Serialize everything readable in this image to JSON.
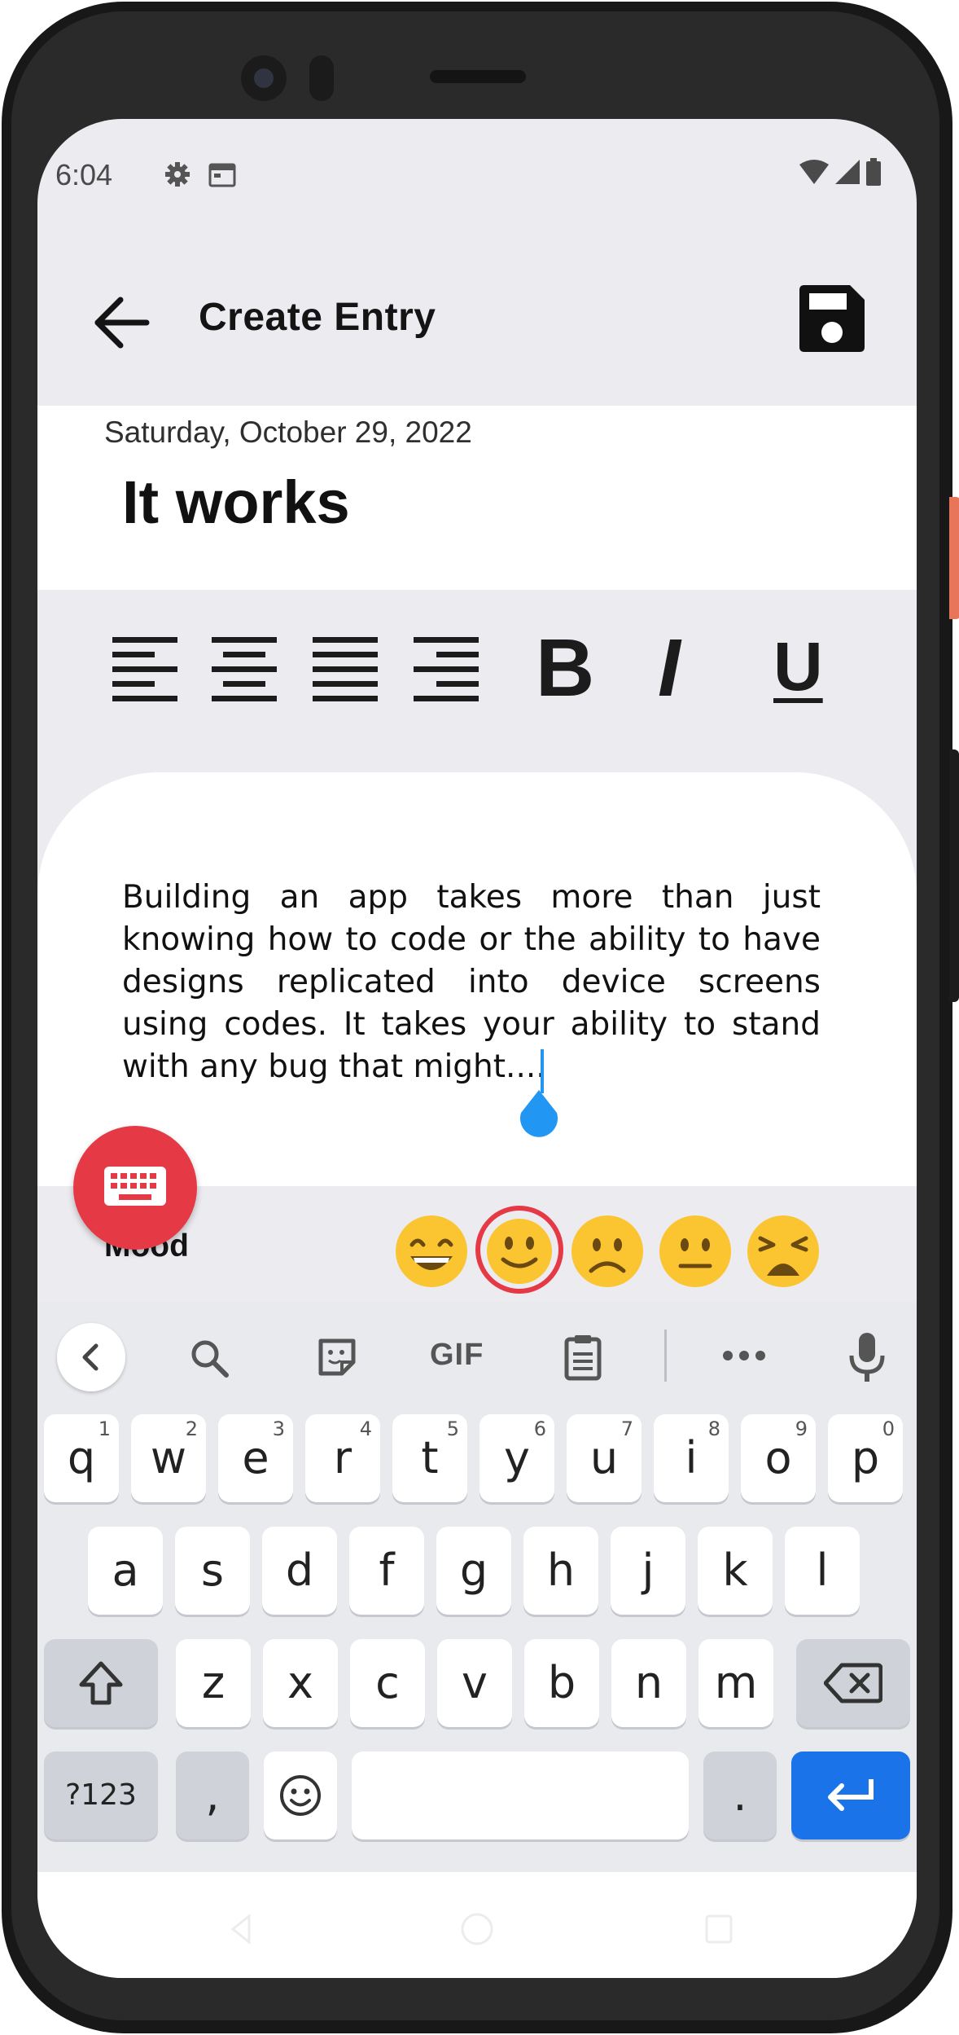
{
  "status_bar": {
    "time": "6:04",
    "left_icons": [
      "gear-icon",
      "calendar-icon"
    ],
    "right_icons": [
      "wifi-icon",
      "signal-icon",
      "battery-icon"
    ]
  },
  "app_bar": {
    "title": "Create Entry",
    "back_icon": "arrow-left-icon",
    "save_icon": "floppy-disk-icon"
  },
  "entry": {
    "date": "Saturday, October 29, 2022",
    "title": "It works",
    "body": "Building an app takes more than just knowing how to code or the ability to have designs replicated into device screens using codes. It takes your ability to stand with any bug that might...."
  },
  "format_toolbar": {
    "align_left_icon": "align-left-icon",
    "align_center_icon": "align-center-icon",
    "align_justify_icon": "align-justify-icon",
    "align_right_icon": "align-right-icon",
    "bold_label": "B",
    "italic_label": "I",
    "underline_label": "U"
  },
  "mood": {
    "label": "Mood",
    "options": [
      "grinning",
      "slightly-smiling",
      "frowning",
      "neutral",
      "weary"
    ],
    "selected": "slightly-smiling",
    "selected_color": "#e63946"
  },
  "keyboard": {
    "toolbar": {
      "gif_label": "GIF",
      "icons": [
        "chevron-left-icon",
        "search-icon",
        "sticker-icon",
        "clipboard-icon",
        "more-icon",
        "mic-icon"
      ]
    },
    "row1": [
      {
        "k": "q",
        "h": "1"
      },
      {
        "k": "w",
        "h": "2"
      },
      {
        "k": "e",
        "h": "3"
      },
      {
        "k": "r",
        "h": "4"
      },
      {
        "k": "t",
        "h": "5"
      },
      {
        "k": "y",
        "h": "6"
      },
      {
        "k": "u",
        "h": "7"
      },
      {
        "k": "i",
        "h": "8"
      },
      {
        "k": "o",
        "h": "9"
      },
      {
        "k": "p",
        "h": "0"
      }
    ],
    "row2": [
      "a",
      "s",
      "d",
      "f",
      "g",
      "h",
      "j",
      "k",
      "l"
    ],
    "row3": [
      "z",
      "x",
      "c",
      "v",
      "b",
      "n",
      "m"
    ],
    "symbols_label": "?123",
    "comma_label": ",",
    "period_label": "."
  },
  "colors": {
    "accent": "#e63946",
    "cursor": "#2196f3",
    "enter_key": "#1a73e8",
    "emoji_yellow": "#fbc531"
  }
}
